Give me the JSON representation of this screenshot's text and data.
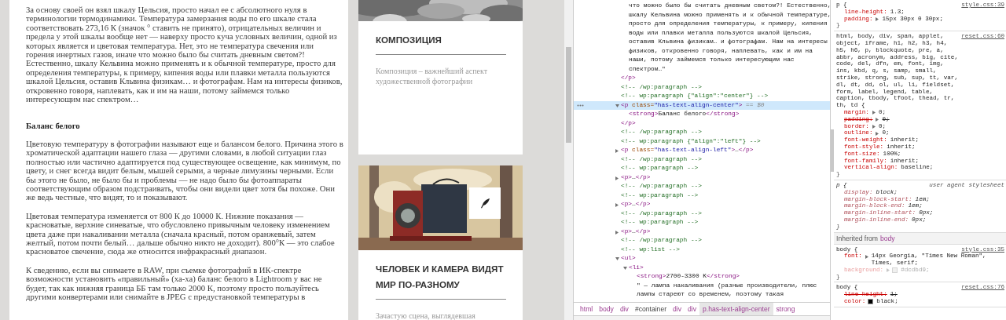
{
  "article": {
    "blocks": [
      {
        "kind": "paragraph",
        "text": "За основу своей он взял шкалу Цельсия, просто начал ее с абсолютного нуля в терминологии термодинамики. Температура замерзания воды по его шкале стала соответствовать 273,16 К (значок ° ставить не принято), отрицательных величин и предела у этой шкалы вообще нет — наверху просто куча условных величин, одной из которых является и цветовая температура. Нет, это не температура свечения или горения инертных газов, иначе что можно было бы считать дневным светом?! Естественно, шкалу Кельвина можно применять и к обычной температуре, просто для определения температуры, к примеру, кипения воды или плавки металла пользуются шкалой Цельсия, оставив Кльвина физикам… и фотографам. Нам на интересы физиков, откровенно говоря, наплевать, как и им на наши, потому займемся только интересующим нас спектром…"
      },
      {
        "kind": "heading",
        "text": "Баланс белого"
      },
      {
        "kind": "paragraph",
        "text": "Цветовую температуру в фотографии называют еще и балансом белого. Причина этого в хроматической адаптации нашего глаза — другими словами, в любой ситуации глаз полностью или частично адаптируется под существующее освещение, как минимум, по цвету, и снег всегда видит белым, мышей серыми, а черные лимузины черными. Если бы этого не было, не было бы и проблемы — не надо было бы фотоаппараты соответствующим образом подстраивать, чтобы они видели цвет хотя бы похоже. Они же ведь честные, что видят, то и показывают."
      },
      {
        "kind": "paragraph",
        "text": "Цветовая температура изменяется от 800 К до 10000 К. Нижние показания — красноватые, верхние синеватые, что обусловлено привычным человеку изменением цвета даже при накаливании металла (сначала красный, потом оранжевый, затем желтый, потом почти белый… дальше обычно никто не доходит). 800°К — это слабое красноватое свечение, сюда же относится инфракрасный диапазон."
      },
      {
        "kind": "paragraph",
        "text": "К сведению, если вы снимаете в RAW, при съемке фотографий в ИК-спектре возможности установить «правильный» (ха-ха) баланс белого в Lightroom у вас не будет, так как нижняя граница ББ там только 2000 К, поэтому просто пользуйтесь другими конвертерами или снимайте в JPEG с предустановкой температуры в"
      }
    ]
  },
  "cards": [
    {
      "title": "КОМПОЗИЦИЯ",
      "description": "Композиция – важнейший аспект художественной фотографии",
      "edit_button": false
    },
    {
      "title": "ЧЕЛОВЕК И КАМЕРА ВИДЯТ МИР ПО-РАЗНОМУ",
      "description": "Зачастую сцена, выглядевшая",
      "edit_button": true
    }
  ],
  "devtools": {
    "dom_tree": [
      {
        "kind": "element",
        "expanded": true,
        "selected": false,
        "close": "</p>",
        "children": [
          {
            "kind": "text",
            "selected": false,
            "lines": [
              "что можно было бы считать дневным светом?! Естественно,",
              "шкалу Кельвина можно применять и к обычной температуре,",
              "просто для определения температуры, к примеру, кипения",
              "воды или плавки металла пользуются шкалой Цельсия,",
              "оставив Кльвина физикам… и фотографам. Нам на интересы",
              "физиков, откровенно говоря, наплевать, как и им на",
              "наши, потому займемся только интересующим нас",
              "спектром…\""
            ]
          }
        ]
      },
      {
        "kind": "comment",
        "selected": false,
        "text": "<!-- /wp:paragraph -->"
      },
      {
        "kind": "comment",
        "selected": false,
        "text": "<!-- wp:paragraph {\"align\":\"center\"} -->"
      },
      {
        "kind": "element",
        "expanded": true,
        "selected": true,
        "open": "<p class=\"has-text-align-center\">",
        "marker": "== $0",
        "close": "</p>",
        "children": [
          {
            "kind": "leaf",
            "selected": false,
            "text": "<strong>Баланс белого</strong>"
          }
        ]
      },
      {
        "kind": "comment",
        "selected": false,
        "text": "<!-- /wp:paragraph -->"
      },
      {
        "kind": "comment",
        "selected": false,
        "text": "<!-- wp:paragraph {\"align\":\"left\"} -->"
      },
      {
        "kind": "element",
        "expanded": false,
        "selected": false,
        "open": "<p class=\"has-text-align-left\">…</p>"
      },
      {
        "kind": "comment",
        "selected": false,
        "text": "<!-- /wp:paragraph -->"
      },
      {
        "kind": "comment",
        "selected": false,
        "text": "<!-- wp:paragraph -->"
      },
      {
        "kind": "element",
        "expanded": false,
        "selected": false,
        "open": "<p>…</p>"
      },
      {
        "kind": "comment",
        "selected": false,
        "text": "<!-- /wp:paragraph -->"
      },
      {
        "kind": "comment",
        "selected": false,
        "text": "<!-- wp:paragraph -->"
      },
      {
        "kind": "element",
        "expanded": false,
        "selected": false,
        "open": "<p>…</p>"
      },
      {
        "kind": "comment",
        "selected": false,
        "text": "<!-- /wp:paragraph -->"
      },
      {
        "kind": "comment",
        "selected": false,
        "text": "<!-- wp:paragraph -->"
      },
      {
        "kind": "element",
        "expanded": false,
        "selected": false,
        "open": "<p>…</p>"
      },
      {
        "kind": "comment",
        "selected": false,
        "text": "<!-- /wp:paragraph -->"
      },
      {
        "kind": "comment",
        "selected": false,
        "text": "<!-- wp:list -->"
      },
      {
        "kind": "element",
        "expanded": true,
        "selected": false,
        "open": "<ul>",
        "children": [
          {
            "kind": "element",
            "expanded": true,
            "selected": false,
            "open": "<li>",
            "children": [
              {
                "kind": "leaf",
                "selected": false,
                "text": "<strong>2700-3300 K</strong>"
              },
              {
                "kind": "text",
                "selected": false,
                "lines": [
                  "\" — лампа накаливания (разные производители, плюс",
                  "лампы стареют со временем, поэтому такая"
                ]
              }
            ]
          }
        ]
      }
    ],
    "breadcrumbs": [
      {
        "label": "html",
        "kind": "tag",
        "selected": false
      },
      {
        "label": "body",
        "kind": "tag",
        "selected": false
      },
      {
        "label": "div",
        "kind": "tag",
        "selected": false
      },
      {
        "label": "#container",
        "kind": "id",
        "selected": false
      },
      {
        "label": "div",
        "kind": "tag",
        "selected": false
      },
      {
        "label": "div",
        "kind": "tag",
        "selected": false
      },
      {
        "label": "p.has-text-align-center",
        "kind": "tag",
        "selected": true
      },
      {
        "label": "strong",
        "kind": "tag",
        "selected": false
      }
    ],
    "styles": [
      {
        "kind": "rule",
        "user_agent": false,
        "selector": "p {",
        "source": "style.css:39",
        "close": "}",
        "properties": [
          {
            "name": "line-height:",
            "value": "1.3;",
            "overridden": false,
            "inactive": false,
            "expandable": false
          },
          {
            "name": "padding:",
            "value": "15px 30px 0 30px;",
            "overridden": false,
            "inactive": false,
            "expandable": true
          }
        ]
      },
      {
        "kind": "rule",
        "user_agent": false,
        "selector": "html, body, div, span, applet, object, iframe, h1, h2, h3, h4, h5, h6, p, blockquote, pre, a, abbr, acronym, address, big, cite, code, del, dfn, em, font, img, ins, kbd, q, s, samp, small, strike, strong, sub, sup, tt, var, dl, dt, dd, ol, ul, li, fieldset, form, label, legend, table, caption, tbody, tfoot, thead, tr, th, td {",
        "source": "reset.css:60",
        "close": "}",
        "properties": [
          {
            "name": "margin:",
            "value": "0;",
            "overridden": false,
            "inactive": false,
            "expandable": true
          },
          {
            "name": "padding:",
            "value": "0;",
            "overridden": true,
            "inactive": false,
            "expandable": true
          },
          {
            "name": "border:",
            "value": "0;",
            "overridden": false,
            "inactive": false,
            "expandable": true
          },
          {
            "name": "outline:",
            "value": "0;",
            "overridden": false,
            "inactive": false,
            "expandable": true
          },
          {
            "name": "font-weight:",
            "value": "inherit;",
            "overridden": false,
            "inactive": false,
            "expandable": false
          },
          {
            "name": "font-style:",
            "value": "inherit;",
            "overridden": false,
            "inactive": false,
            "expandable": false
          },
          {
            "name": "font-size:",
            "value": "100%;",
            "overridden": false,
            "inactive": false,
            "expandable": false
          },
          {
            "name": "font-family:",
            "value": "inherit;",
            "overridden": false,
            "inactive": false,
            "expandable": false
          },
          {
            "name": "vertical-align:",
            "value": "baseline;",
            "overridden": false,
            "inactive": false,
            "expandable": false
          }
        ]
      },
      {
        "kind": "rule",
        "user_agent": true,
        "selector": "p {",
        "source": "user agent stylesheet",
        "close": "}",
        "properties": [
          {
            "name": "display:",
            "value": "block;",
            "overridden": false,
            "inactive": false,
            "expandable": false
          },
          {
            "name": "margin-block-start:",
            "value": "1em;",
            "overridden": false,
            "inactive": false,
            "expandable": false
          },
          {
            "name": "margin-block-end:",
            "value": "1em;",
            "overridden": false,
            "inactive": false,
            "expandable": false
          },
          {
            "name": "margin-inline-start:",
            "value": "0px;",
            "overridden": false,
            "inactive": false,
            "expandable": false
          },
          {
            "name": "margin-inline-end:",
            "value": "0px;",
            "overridden": false,
            "inactive": false,
            "expandable": false
          }
        ]
      },
      {
        "kind": "inherited",
        "text": "Inherited from",
        "element": "body"
      },
      {
        "kind": "rule",
        "user_agent": false,
        "selector": "body {",
        "source": "style.css:35",
        "close": "}",
        "properties": [
          {
            "name": "font:",
            "value": "14px Georgia, \"Times New Roman\", Times, serif;",
            "overridden": false,
            "inactive": false,
            "expandable": true
          },
          {
            "name": "background:",
            "value": "#dcdbd9;",
            "overridden": false,
            "inactive": true,
            "expandable": true,
            "color": "#dcdbd9"
          }
        ]
      },
      {
        "kind": "rule",
        "user_agent": false,
        "selector": "body {",
        "source": "reset.css:76",
        "properties": [
          {
            "name": "line-height:",
            "value": "1;",
            "overridden": true,
            "inactive": false,
            "expandable": false
          },
          {
            "name": "color:",
            "value": "black;",
            "overridden": false,
            "inactive": false,
            "expandable": false,
            "color": "#000000"
          }
        ]
      }
    ]
  }
}
